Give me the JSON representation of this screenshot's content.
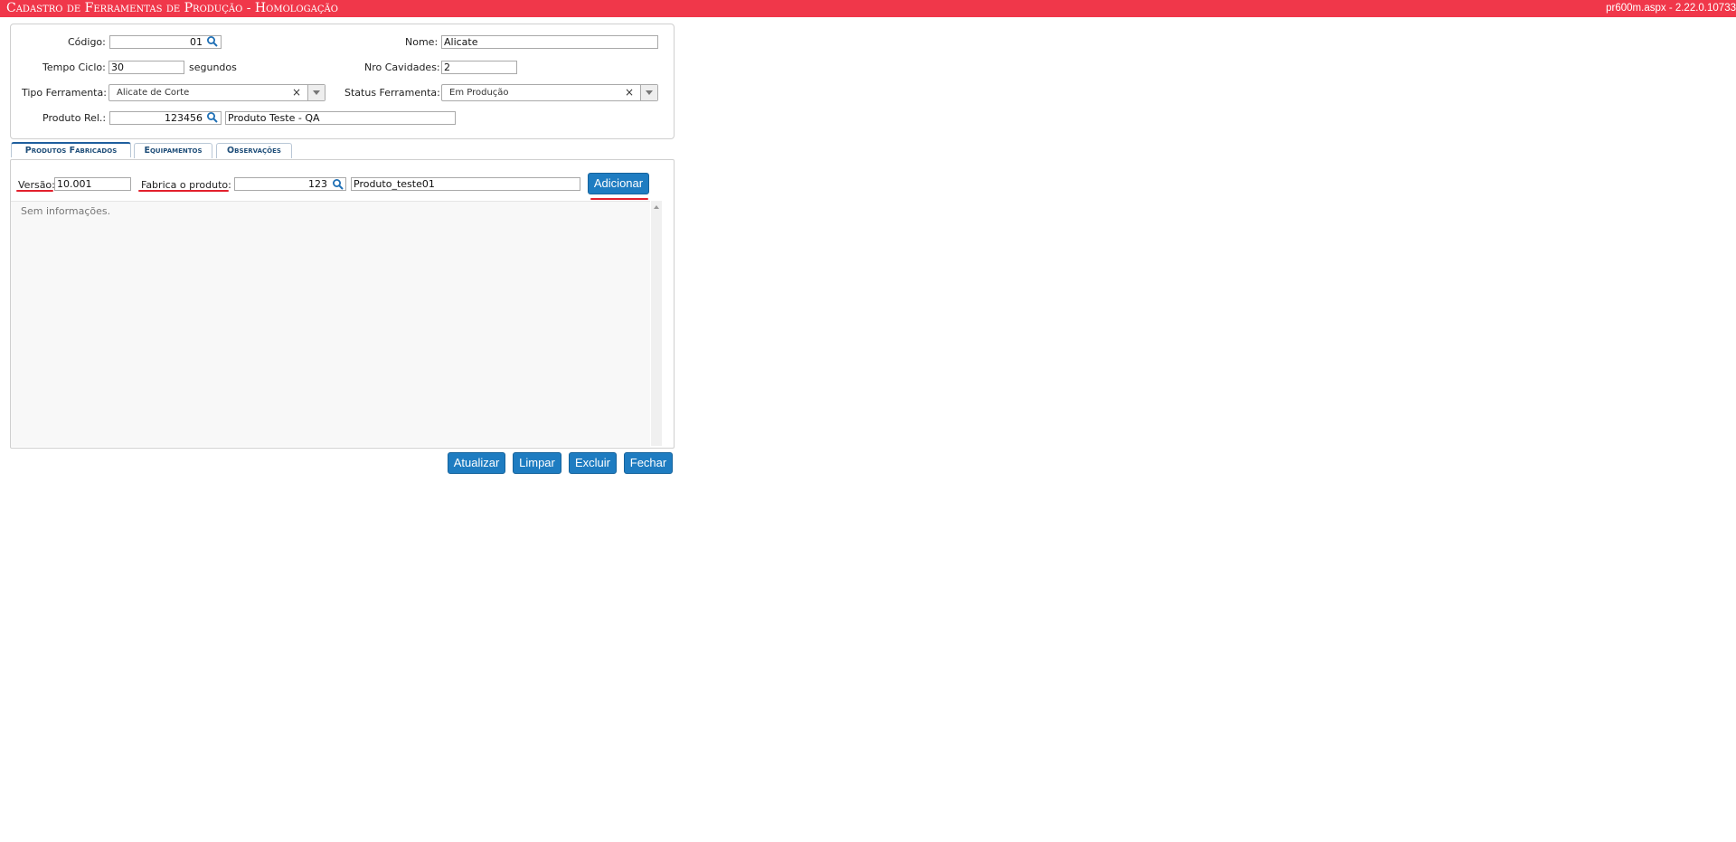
{
  "header": {
    "title": "Cadastro de Ferramentas de Produção  - Homologação",
    "version": "pr600m.aspx - 2.22.0.10733"
  },
  "form": {
    "codigo": {
      "label": "Código:",
      "value": "01"
    },
    "nome": {
      "label": "Nome:",
      "value": "Alicate"
    },
    "tempo_ciclo": {
      "label": "Tempo Ciclo:",
      "value": "30",
      "unit": "segundos"
    },
    "nro_cavidades": {
      "label": "Nro Cavidades:",
      "value": "2"
    },
    "tipo_ferramenta": {
      "label": "Tipo Ferramenta:",
      "value": "Alicate de Corte",
      "clear": "×"
    },
    "status_ferramenta": {
      "label": "Status Ferramenta:",
      "value": "Em Produção",
      "clear": "×"
    },
    "produto_rel": {
      "label": "Produto Rel.:",
      "code": "123456",
      "description": "Produto Teste - QA"
    }
  },
  "tabs": [
    {
      "label": "Produtos Fabricados",
      "active": true
    },
    {
      "label": "Equipamentos",
      "active": false
    },
    {
      "label": "Observações",
      "active": false
    }
  ],
  "produtos": {
    "versao": {
      "label": "Versão:",
      "value": "10.001"
    },
    "fabrica": {
      "label": "Fabrica o produto:",
      "code": "123",
      "description": "Produto_teste01"
    },
    "add_button": "Adicionar",
    "empty_text": "Sem informações."
  },
  "actions": {
    "atualizar": "Atualizar",
    "limpar": "Limpar",
    "excluir": "Excluir",
    "fechar": "Fechar"
  },
  "colors": {
    "header_bg": "#f0374a",
    "button_bg": "#1e7cc1",
    "underline": "#e3202c",
    "tab_text": "#1f4e79"
  },
  "icons": {
    "lookup": "search-icon",
    "dropdown": "chevron-down-icon",
    "clear": "clear-icon"
  }
}
